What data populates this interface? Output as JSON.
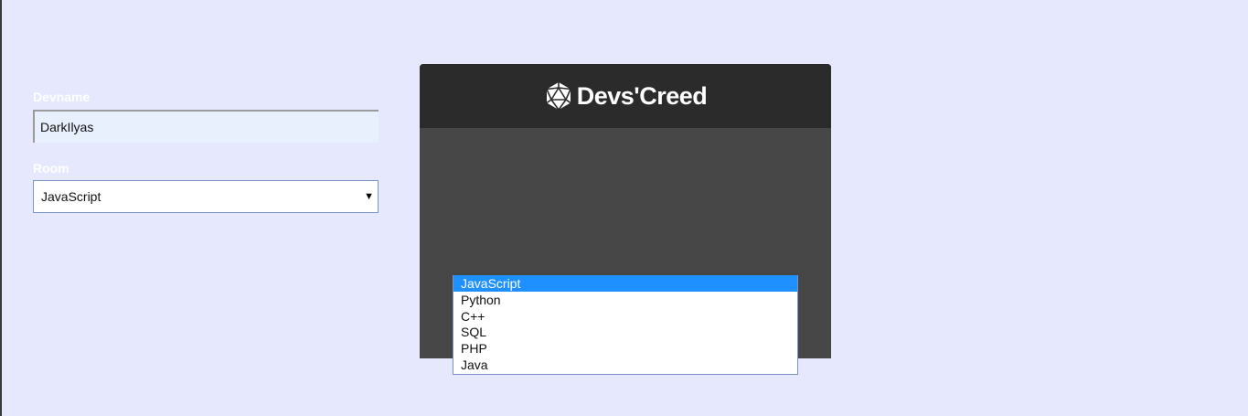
{
  "brand": {
    "name": "Devs'Creed",
    "icon": "d20-icon"
  },
  "form": {
    "devname": {
      "label": "Devname",
      "value": "DarkIlyas"
    },
    "room": {
      "label": "Room",
      "selected": "JavaScript",
      "options": [
        "JavaScript",
        "Python",
        "C++",
        "SQL",
        "PHP",
        "Java"
      ]
    }
  },
  "colors": {
    "page_background": "#e6e9fd",
    "header_background": "#2b2b2b",
    "card_background": "#474747",
    "highlight": "#1e90ff"
  }
}
